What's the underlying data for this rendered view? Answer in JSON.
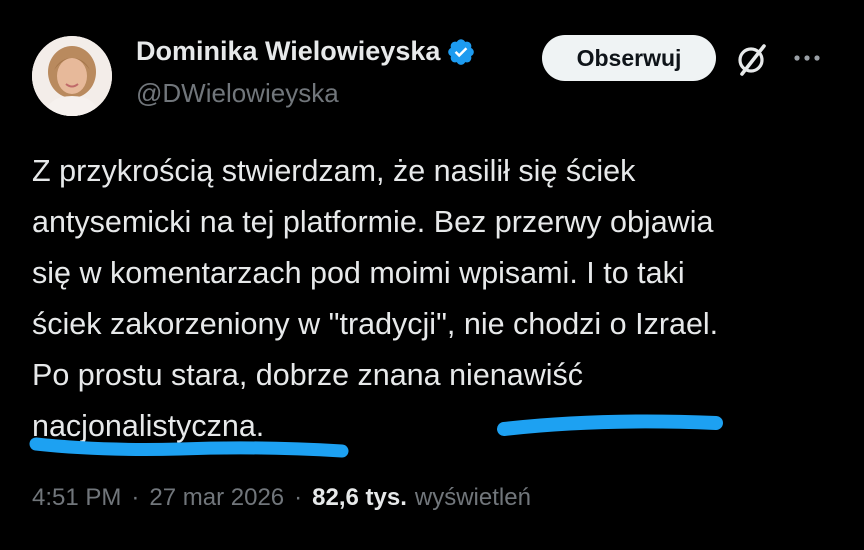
{
  "author": {
    "display_name": "Dominika Wielowieyska",
    "handle": "@DWielowieyska",
    "verified_color": "#1d9bf0",
    "avatar_icon": "profile-photo"
  },
  "actions": {
    "follow_label": "Obserwuj",
    "grok_icon": "grok-icon",
    "more_icon": "more-horizontal-icon"
  },
  "tweet": {
    "lines": [
      "Z przykrością stwierdzam, że nasilił się ściek",
      "antysemicki na tej platformie. Bez przerwy objawia",
      "się w komentarzach pod moimi wpisami. I to taki",
      "ściek zakorzeniony w \"tradycji\", nie chodzi o Izrael.",
      "Po prostu stara, dobrze znana nienawiść",
      "nacjonalistyczna."
    ]
  },
  "meta": {
    "time": "4:51 PM",
    "separator": "·",
    "date": "27 mar 2026",
    "views_count": "82,6 tys.",
    "views_label": "wyświetleń"
  },
  "colors": {
    "background": "#000000",
    "text": "#e7e9ea",
    "secondary": "#71767b",
    "annotation": "#1da1f2"
  }
}
